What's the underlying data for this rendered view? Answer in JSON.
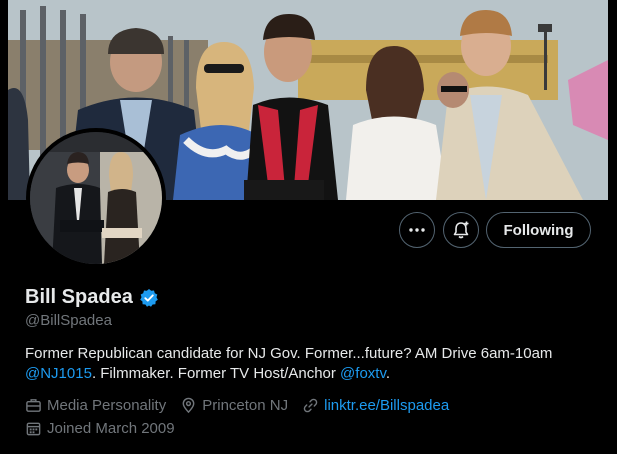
{
  "profile": {
    "display_name": "Bill Spadea",
    "verified_icon": "verified-badge-icon",
    "handle": "@BillSpadea",
    "bio_part1": "Former Republican candidate for NJ Gov. Former...future? AM Drive 6am-10am ",
    "bio_mention1": "@NJ1015",
    "bio_part2": ". Filmmaker. Former TV Host/Anchor ",
    "bio_mention2": "@foxtv",
    "bio_part3": ".",
    "category": "Media Personality",
    "location": "Princeton NJ",
    "website": "linktr.ee/Billspadea",
    "joined": "Joined March 2009"
  },
  "actions": {
    "more_icon": "more-icon",
    "notify_icon": "notification-bell-icon",
    "following_label": "Following"
  },
  "colors": {
    "background": "#000000",
    "text_primary": "#e7e9ea",
    "text_secondary": "#71767b",
    "accent": "#1d9bf0",
    "border": "#536471"
  }
}
